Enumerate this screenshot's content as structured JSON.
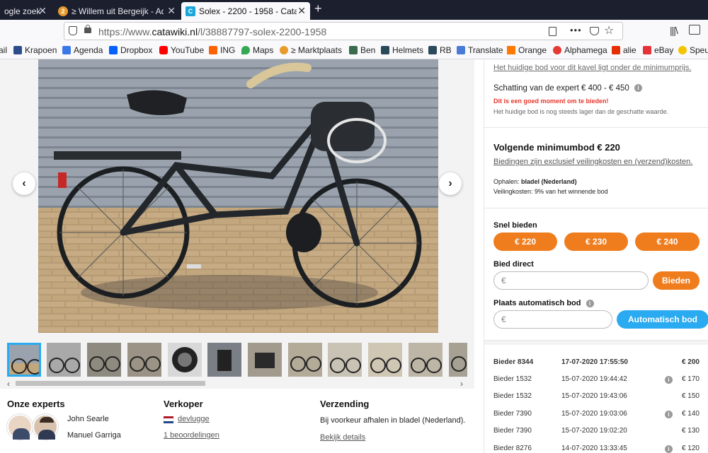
{
  "browser": {
    "tabs": [
      {
        "label": "ogle zoek",
        "active": false
      },
      {
        "label": "≥ Willem uit Bergeijk - Ad",
        "active": false
      },
      {
        "label": "Solex - 2200 - 1958 - Cata",
        "active": true
      }
    ],
    "new_tab": "+",
    "url_prefix": "https://www.",
    "url_domain": "catawiki.nl",
    "url_path": "/l/38887797-solex-2200-1958",
    "url_menu": "•••",
    "bookmarks": [
      "ail",
      "Krapoen",
      "Agenda",
      "Dropbox",
      "YouTube",
      "ING",
      "Maps",
      "≥ Marktplaats",
      "Ben",
      "Helmets",
      "RB",
      "Translate",
      "Orange",
      "Alphamega",
      "alie",
      "eBay",
      "Speu"
    ]
  },
  "gallery": {
    "prev": "‹",
    "next": "›",
    "scroll_left": "‹",
    "scroll_right": "›"
  },
  "info": {
    "experts_title": "Onze experts",
    "experts": [
      "John Searle",
      "Manuel Garriga"
    ],
    "seller_title": "Verkoper",
    "seller_name": "devlugge",
    "seller_reviews": "1 beoordelingen",
    "shipping_title": "Verzending",
    "shipping_text": "Bij voorkeur afhalen in bladel (Nederland).",
    "shipping_link": "Bekijk details"
  },
  "bidding": {
    "reserve_note": "Het huidige bod voor dit kavel ligt onder de minimumprijs.",
    "estimate": "Schatting van de expert € 400 - € 450",
    "good_moment": "Dit is een goed moment om te bieden!",
    "below_estimate": "Het huidige bod is nog steeds lager dan de geschatte waarde.",
    "next_min_bid": "Volgende minimumbod € 220",
    "excl_costs": "Biedingen zijn exclusief veilingkosten en (verzend)kosten.",
    "pickup_label": "Ophalen:",
    "pickup_value": "bladel (Nederland)",
    "fee": "Veilingkosten: 9% van het winnende bod",
    "quick_bid_title": "Snel bieden",
    "quick_bids": [
      "€ 220",
      "€ 230",
      "€ 240"
    ],
    "direct_bid_title": "Bied direct",
    "currency": "€",
    "bid_button": "Bieden",
    "auto_bid_title": "Plaats automatisch bod",
    "auto_bid_button": "Automatisch bod"
  },
  "bid_history": [
    {
      "bidder": "Bieder 8344",
      "time": "17-07-2020 17:55:50",
      "amount": "€ 200",
      "info": false,
      "bold": true
    },
    {
      "bidder": "Bieder 1532",
      "time": "15-07-2020 19:44:42",
      "amount": "€ 170",
      "info": true,
      "bold": false
    },
    {
      "bidder": "Bieder 1532",
      "time": "15-07-2020 19:43:06",
      "amount": "€ 150",
      "info": false,
      "bold": false
    },
    {
      "bidder": "Bieder 7390",
      "time": "15-07-2020 19:03:06",
      "amount": "€ 140",
      "info": true,
      "bold": false
    },
    {
      "bidder": "Bieder 7390",
      "time": "15-07-2020 19:02:20",
      "amount": "€ 130",
      "info": false,
      "bold": false
    },
    {
      "bidder": "Bieder 8276",
      "time": "14-07-2020 13:33:45",
      "amount": "€ 120",
      "info": true,
      "bold": false
    }
  ],
  "colors": {
    "accent": "#ef7d1e",
    "blue": "#2aaaf0",
    "link": "#555555",
    "red": "#e8372c"
  }
}
